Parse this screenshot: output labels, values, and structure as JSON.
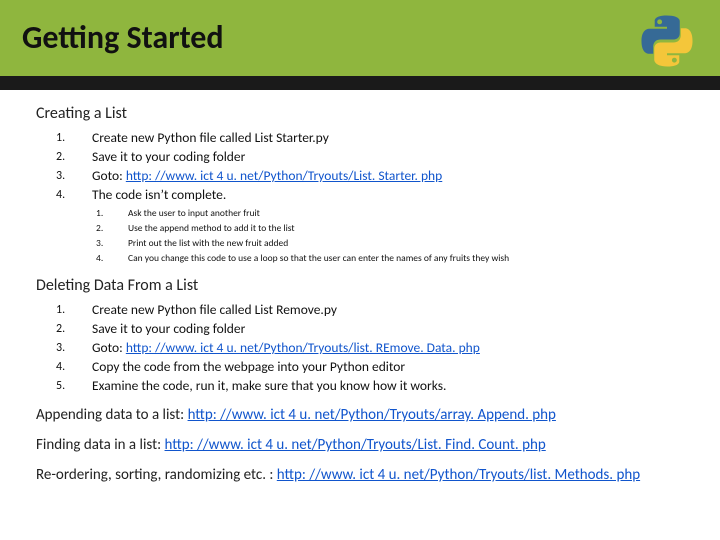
{
  "header": {
    "title": "Getting Started",
    "logo_alt": "python-logo"
  },
  "section_create": {
    "heading": "Creating a List",
    "items": [
      {
        "text": "Create new Python file called List Starter.py"
      },
      {
        "text_prefix": "Save it to your coding folder"
      },
      {
        "text_prefix": "Goto: ",
        "link": "http: //www. ict 4 u. net/Python/Tryouts/List. Starter. php"
      },
      {
        "text_prefix": "The code isn’t complete."
      }
    ],
    "sub_items": [
      "Ask the user to input another fruit",
      "Use the append method to add it to the list",
      "Print out the list with the new fruit added",
      "Can you change this code to use a loop so that the user can enter the names of any fruits they wish"
    ]
  },
  "section_delete": {
    "heading": "Deleting Data From a List",
    "items": [
      {
        "text": "Create new Python file called List Remove.py"
      },
      {
        "text": "Save it to your coding folder"
      },
      {
        "text_prefix": "Goto: ",
        "link": "http: //www. ict 4 u. net/Python/Tryouts/list. REmove. Data. php"
      },
      {
        "text": "Copy the code from the webpage into your Python editor"
      },
      {
        "text": "Examine the code, run it, make sure that you know how it works."
      }
    ]
  },
  "paragraphs": {
    "append": {
      "prefix": "Appending data to a list:  ",
      "link": "http: //www. ict 4 u. net/Python/Tryouts/array. Append. php"
    },
    "find": {
      "prefix": "Finding data in a list: ",
      "link": "http: //www. ict 4 u. net/Python/Tryouts/List. Find. Count. php"
    },
    "reorder": {
      "prefix": "Re-ordering, sorting, randomizing etc. : ",
      "link": "http: //www. ict 4 u. net/Python/Tryouts/list. Methods. php"
    }
  }
}
